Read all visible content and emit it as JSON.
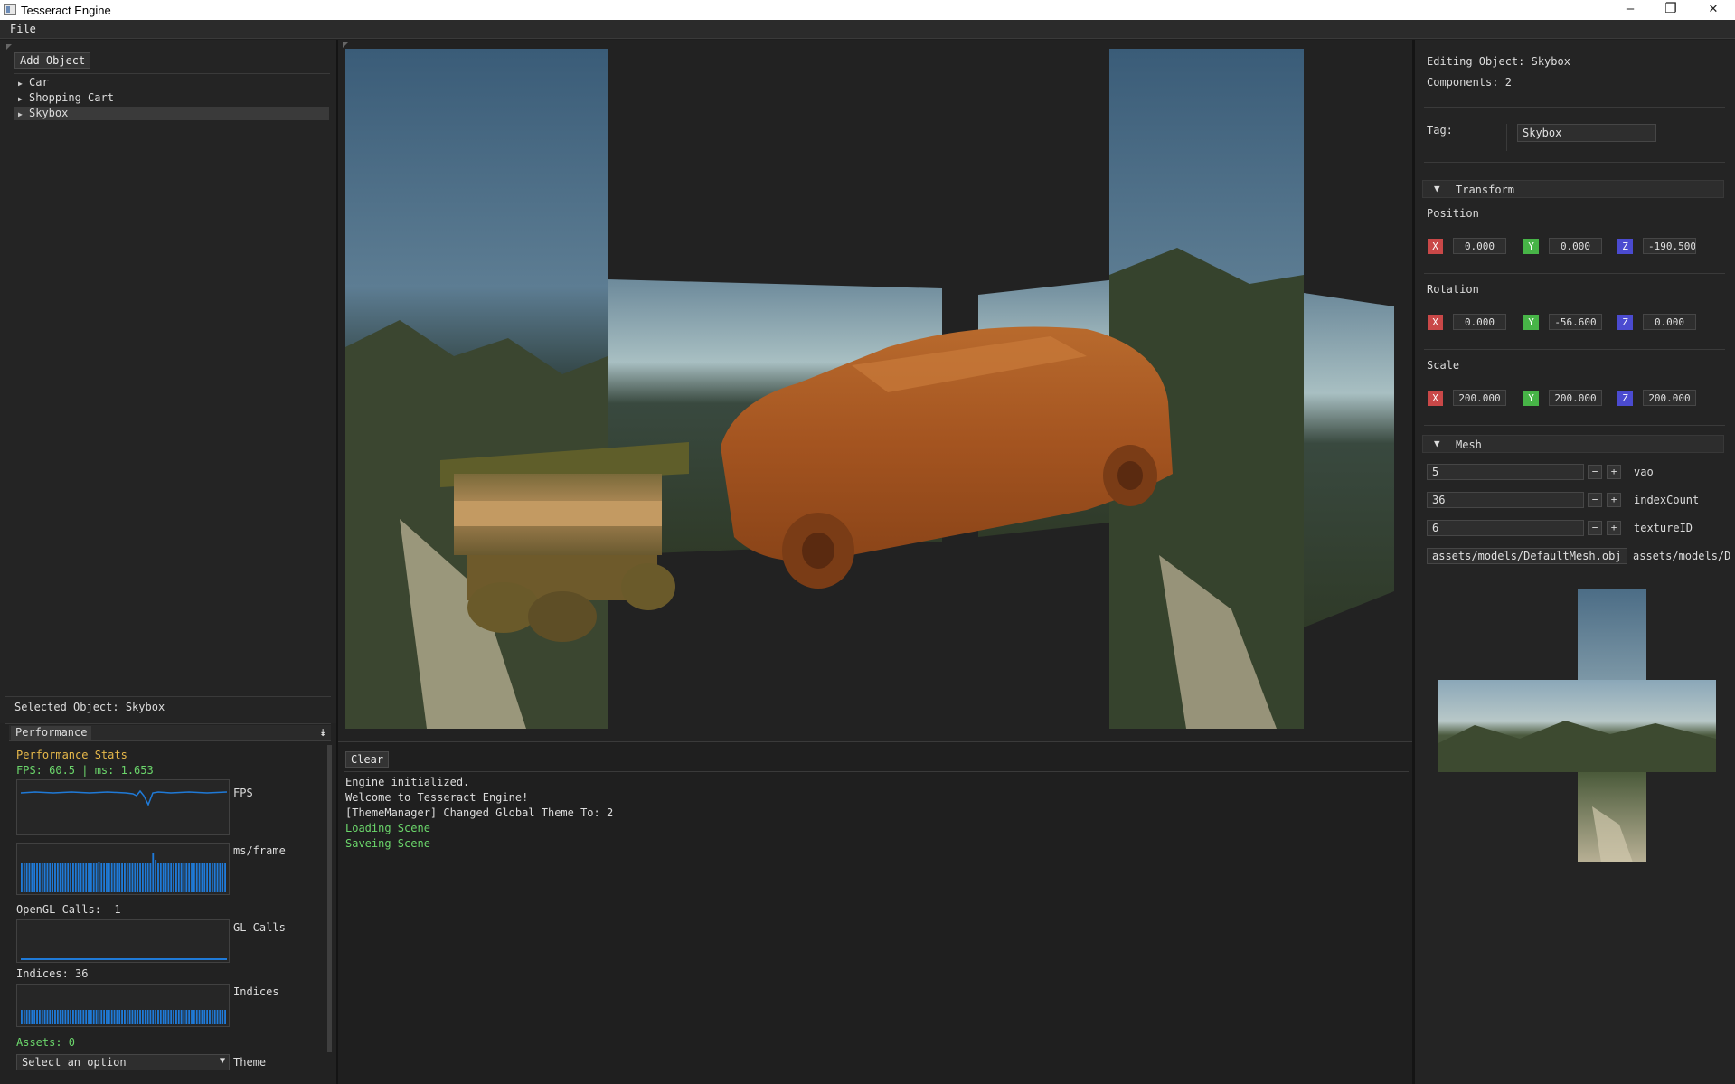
{
  "window": {
    "title": "Tesseract Engine",
    "minimize": "–",
    "maximize": "❐",
    "close": "✕"
  },
  "menu": {
    "file": "File"
  },
  "hierarchy": {
    "add_button": "Add Object",
    "items": [
      {
        "label": "Car"
      },
      {
        "label": "Shopping Cart"
      },
      {
        "label": "Skybox"
      }
    ],
    "selected": "Selected Object: Skybox"
  },
  "performance": {
    "tab": "Performance",
    "heading": "Performance Stats",
    "fps_line": "FPS: 60.5 | ms: 1.653",
    "fps_graph_label": "FPS",
    "ms_graph_label": "ms/frame",
    "gl_calls_text": "OpenGL Calls: -1",
    "gl_graph_label": "GL Calls",
    "indices_text": "Indices: 36",
    "indices_graph_label": "Indices",
    "assets_text": "Assets: 0",
    "theme_select": "Select an option",
    "theme_label": "Theme"
  },
  "console": {
    "clear_button": "Clear",
    "lines": [
      {
        "text": "Engine initialized.",
        "color": "#dcdcdc"
      },
      {
        "text": "Welcome to Tesseract Engine!",
        "color": "#dcdcdc"
      },
      {
        "text": "[ThemeManager] Changed Global Theme To: 2",
        "color": "#dcdcdc"
      },
      {
        "text": "Loading Scene",
        "color": "#6bd66b"
      },
      {
        "text": "Saveing Scene",
        "color": "#6bd66b"
      }
    ]
  },
  "inspector": {
    "editing": "Editing Object: Skybox",
    "components": "Components: 2",
    "tag_label": "Tag:",
    "tag_value": "Skybox",
    "transform_header": "Transform",
    "position_label": "Position",
    "rotation_label": "Rotation",
    "scale_label": "Scale",
    "axis_letters": {
      "x": "X",
      "y": "Y",
      "z": "Z"
    },
    "position": {
      "x": "0.000",
      "y": "0.000",
      "z": "-190.500"
    },
    "rotation": {
      "x": "0.000",
      "y": "-56.600",
      "z": "0.000"
    },
    "scale": {
      "x": "200.000",
      "y": "200.000",
      "z": "200.000"
    },
    "mesh_header": "Mesh",
    "vao_value": "5",
    "vao_label": "vao",
    "indexcount_value": "36",
    "indexcount_label": "indexCount",
    "textureid_value": "6",
    "textureid_label": "textureID",
    "mesh_path_value": "assets/models/DefaultMesh.obj",
    "mesh_path_label": "assets/models/D",
    "minus": "−",
    "plus": "+"
  },
  "colors": {
    "accent_blue": "#1f7ad8",
    "green_text": "#6bd66b",
    "yellow_text": "#e6b84a"
  }
}
